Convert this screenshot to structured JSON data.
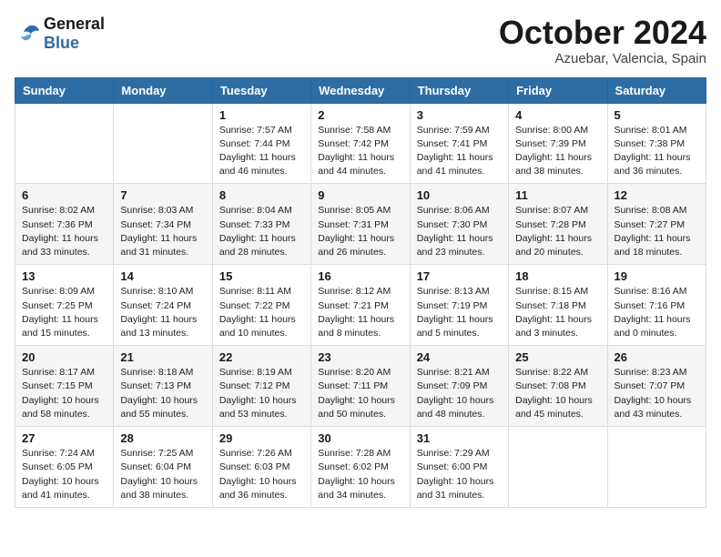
{
  "header": {
    "logo_line1": "General",
    "logo_line2": "Blue",
    "month_title": "October 2024",
    "location": "Azuebar, Valencia, Spain"
  },
  "weekdays": [
    "Sunday",
    "Monday",
    "Tuesday",
    "Wednesday",
    "Thursday",
    "Friday",
    "Saturday"
  ],
  "weeks": [
    [
      null,
      null,
      {
        "day": 1,
        "sunrise": "7:57 AM",
        "sunset": "7:44 PM",
        "daylight": "11 hours and 46 minutes."
      },
      {
        "day": 2,
        "sunrise": "7:58 AM",
        "sunset": "7:42 PM",
        "daylight": "11 hours and 44 minutes."
      },
      {
        "day": 3,
        "sunrise": "7:59 AM",
        "sunset": "7:41 PM",
        "daylight": "11 hours and 41 minutes."
      },
      {
        "day": 4,
        "sunrise": "8:00 AM",
        "sunset": "7:39 PM",
        "daylight": "11 hours and 38 minutes."
      },
      {
        "day": 5,
        "sunrise": "8:01 AM",
        "sunset": "7:38 PM",
        "daylight": "11 hours and 36 minutes."
      }
    ],
    [
      {
        "day": 6,
        "sunrise": "8:02 AM",
        "sunset": "7:36 PM",
        "daylight": "11 hours and 33 minutes."
      },
      {
        "day": 7,
        "sunrise": "8:03 AM",
        "sunset": "7:34 PM",
        "daylight": "11 hours and 31 minutes."
      },
      {
        "day": 8,
        "sunrise": "8:04 AM",
        "sunset": "7:33 PM",
        "daylight": "11 hours and 28 minutes."
      },
      {
        "day": 9,
        "sunrise": "8:05 AM",
        "sunset": "7:31 PM",
        "daylight": "11 hours and 26 minutes."
      },
      {
        "day": 10,
        "sunrise": "8:06 AM",
        "sunset": "7:30 PM",
        "daylight": "11 hours and 23 minutes."
      },
      {
        "day": 11,
        "sunrise": "8:07 AM",
        "sunset": "7:28 PM",
        "daylight": "11 hours and 20 minutes."
      },
      {
        "day": 12,
        "sunrise": "8:08 AM",
        "sunset": "7:27 PM",
        "daylight": "11 hours and 18 minutes."
      }
    ],
    [
      {
        "day": 13,
        "sunrise": "8:09 AM",
        "sunset": "7:25 PM",
        "daylight": "11 hours and 15 minutes."
      },
      {
        "day": 14,
        "sunrise": "8:10 AM",
        "sunset": "7:24 PM",
        "daylight": "11 hours and 13 minutes."
      },
      {
        "day": 15,
        "sunrise": "8:11 AM",
        "sunset": "7:22 PM",
        "daylight": "11 hours and 10 minutes."
      },
      {
        "day": 16,
        "sunrise": "8:12 AM",
        "sunset": "7:21 PM",
        "daylight": "11 hours and 8 minutes."
      },
      {
        "day": 17,
        "sunrise": "8:13 AM",
        "sunset": "7:19 PM",
        "daylight": "11 hours and 5 minutes."
      },
      {
        "day": 18,
        "sunrise": "8:15 AM",
        "sunset": "7:18 PM",
        "daylight": "11 hours and 3 minutes."
      },
      {
        "day": 19,
        "sunrise": "8:16 AM",
        "sunset": "7:16 PM",
        "daylight": "11 hours and 0 minutes."
      }
    ],
    [
      {
        "day": 20,
        "sunrise": "8:17 AM",
        "sunset": "7:15 PM",
        "daylight": "10 hours and 58 minutes."
      },
      {
        "day": 21,
        "sunrise": "8:18 AM",
        "sunset": "7:13 PM",
        "daylight": "10 hours and 55 minutes."
      },
      {
        "day": 22,
        "sunrise": "8:19 AM",
        "sunset": "7:12 PM",
        "daylight": "10 hours and 53 minutes."
      },
      {
        "day": 23,
        "sunrise": "8:20 AM",
        "sunset": "7:11 PM",
        "daylight": "10 hours and 50 minutes."
      },
      {
        "day": 24,
        "sunrise": "8:21 AM",
        "sunset": "7:09 PM",
        "daylight": "10 hours and 48 minutes."
      },
      {
        "day": 25,
        "sunrise": "8:22 AM",
        "sunset": "7:08 PM",
        "daylight": "10 hours and 45 minutes."
      },
      {
        "day": 26,
        "sunrise": "8:23 AM",
        "sunset": "7:07 PM",
        "daylight": "10 hours and 43 minutes."
      }
    ],
    [
      {
        "day": 27,
        "sunrise": "7:24 AM",
        "sunset": "6:05 PM",
        "daylight": "10 hours and 41 minutes."
      },
      {
        "day": 28,
        "sunrise": "7:25 AM",
        "sunset": "6:04 PM",
        "daylight": "10 hours and 38 minutes."
      },
      {
        "day": 29,
        "sunrise": "7:26 AM",
        "sunset": "6:03 PM",
        "daylight": "10 hours and 36 minutes."
      },
      {
        "day": 30,
        "sunrise": "7:28 AM",
        "sunset": "6:02 PM",
        "daylight": "10 hours and 34 minutes."
      },
      {
        "day": 31,
        "sunrise": "7:29 AM",
        "sunset": "6:00 PM",
        "daylight": "10 hours and 31 minutes."
      },
      null,
      null
    ]
  ]
}
